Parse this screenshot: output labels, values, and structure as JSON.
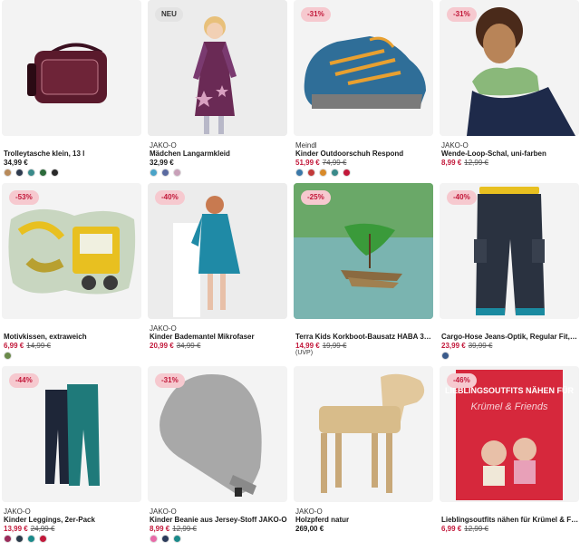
{
  "products": [
    {
      "badge": "",
      "brand": "",
      "name": "Trolleytasche klein, 13 l",
      "price": "34,99 €",
      "old_price": "",
      "swatches": [
        "#b88a5a",
        "#2e3a4e",
        "#3a8a8a",
        "#2c6a3a",
        "#2a2a2a"
      ],
      "image": "bag-image"
    },
    {
      "badge": "NEU",
      "brand": "JAKO-O",
      "name": "Mädchen Langarmkleid",
      "price": "32,99 €",
      "old_price": "",
      "swatches": [
        "#4aa3c8",
        "#5a6aa0",
        "#c8a0b8"
      ],
      "image": "dress-image"
    },
    {
      "badge": "-31%",
      "brand": "Meindl",
      "name": "Kinder Outdoorschuh Respond",
      "price": "51,99 €",
      "old_price": "74,99 €",
      "swatches": [
        "#3a78a8",
        "#c23a3a",
        "#d88a2a",
        "#3a8a8a",
        "#c2183a"
      ],
      "image": "shoe-image"
    },
    {
      "badge": "-31%",
      "brand": "JAKO-O",
      "name": "Wende-Loop-Schal, uni-farben",
      "price": "8,99 €",
      "old_price": "12,99 €",
      "swatches": [],
      "image": "scarf-image"
    },
    {
      "badge": "-53%",
      "brand": "",
      "name": "Motivkissen, extraweich",
      "price": "6,99 €",
      "old_price": "14,99 €",
      "swatches": [
        "#6a8a4a"
      ],
      "image": "pillow-image"
    },
    {
      "badge": "-40%",
      "brand": "JAKO-O",
      "name": "Kinder Bademantel Mikrofaser",
      "price": "20,99 €",
      "old_price": "34,99 €",
      "swatches": [],
      "image": "bathrobe-image"
    },
    {
      "badge": "-25%",
      "brand": "",
      "name": "Terra Kids Korkboot-Bausatz HABA 304...",
      "price": "14,99 €",
      "old_price": "19,99 €",
      "uvp": "(UVP)",
      "swatches": [],
      "image": "boat-image"
    },
    {
      "badge": "-40%",
      "brand": "",
      "name": "Cargo-Hose Jeans-Optik, Regular Fit, J...",
      "price": "23,99 €",
      "old_price": "39,99 €",
      "swatches": [
        "#3a5a8a"
      ],
      "image": "pants-image"
    },
    {
      "badge": "-44%",
      "brand": "JAKO-O",
      "name": "Kinder Leggings, 2er-Pack",
      "price": "13,99 €",
      "old_price": "24,99 €",
      "swatches": [
        "#9a2a5a",
        "#2a3a4a",
        "#1a8a8a",
        "#c2183a"
      ],
      "image": "leggings-image"
    },
    {
      "badge": "-31%",
      "brand": "JAKO-O",
      "name": "Kinder Beanie aus Jersey-Stoff JAKO-O",
      "price": "8,99 €",
      "old_price": "12,99 €",
      "swatches": [
        "#e86aa8",
        "#2a3a5a",
        "#1a8a8a"
      ],
      "image": "beanie-image"
    },
    {
      "badge": "",
      "brand": "JAKO-O",
      "name": "Holzpferd natur",
      "price": "269,00 €",
      "old_price": "",
      "swatches": [],
      "image": "horse-image"
    },
    {
      "badge": "-46%",
      "brand": "",
      "name": "Lieblingsoutfits nähen für Krümel & Fri...",
      "price": "6,99 €",
      "old_price": "12,99 €",
      "swatches": [],
      "image": "book-image",
      "book": {
        "title": "LIEBLINGSOUTFITS NÄHEN FÜR",
        "subtitle": "Krümel & Friends"
      }
    }
  ]
}
